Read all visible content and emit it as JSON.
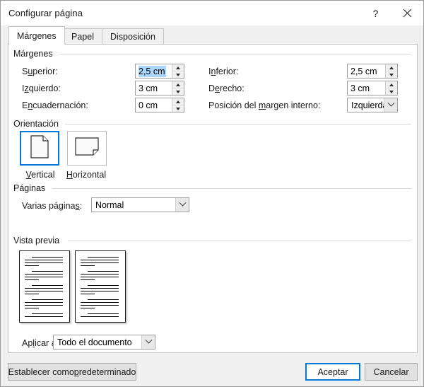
{
  "window": {
    "title": "Configurar página",
    "help_icon": "help-question-icon",
    "close_icon": "close-x-icon"
  },
  "tabs": [
    {
      "label": "Márgenes",
      "active": true
    },
    {
      "label": "Papel",
      "active": false
    },
    {
      "label": "Disposición",
      "active": false
    }
  ],
  "margins": {
    "group_label": "Márgenes",
    "fields": [
      {
        "label_pre": "S",
        "label_key": "u",
        "label_post": "perior:",
        "value": "2,5 cm",
        "selected": true
      },
      {
        "label_pre": "I",
        "label_key": "z",
        "label_post": "quierdo:",
        "value": "3 cm",
        "selected": false
      },
      {
        "label_pre": "E",
        "label_key": "n",
        "label_post": "cuadernación:",
        "value": "0 cm",
        "selected": false
      },
      {
        "label_pre": "I",
        "label_key": "n",
        "label_post": "ferior:",
        "value": "2,5 cm",
        "selected": false
      },
      {
        "label_pre": "D",
        "label_key": "e",
        "label_post": "recho:",
        "value": "3 cm",
        "selected": false
      }
    ],
    "gutter_position": {
      "label_pre": "Posición del ",
      "label_key": "m",
      "label_post": "argen interno:",
      "value": "Izquierda"
    }
  },
  "orientation": {
    "group_label": "Orientación",
    "options": [
      {
        "label_pre": "",
        "label_key": "V",
        "label_post": "ertical",
        "icon": "page-portrait-icon",
        "selected": true
      },
      {
        "label_pre": "",
        "label_key": "H",
        "label_post": "orizontal",
        "icon": "page-landscape-icon",
        "selected": false
      }
    ]
  },
  "pages": {
    "group_label": "Páginas",
    "multiple_pages": {
      "label_pre": "Varias página",
      "label_key": "s",
      "label_post": ":",
      "value": "Normal"
    }
  },
  "preview": {
    "group_label": "Vista previa",
    "pages": 2
  },
  "apply_to": {
    "label_pre": "Ap",
    "label_key": "l",
    "label_post": "icar a:",
    "value": "Todo el documento"
  },
  "buttons": {
    "set_default": {
      "pre": "Establecer como ",
      "key": "p",
      "post": "redeterminado"
    },
    "ok": {
      "label": "Aceptar",
      "default": true
    },
    "cancel": {
      "label": "Cancelar",
      "default": false
    }
  },
  "colors": {
    "accent": "#0078d7",
    "selection": "#add6ff",
    "dialog_bg": "#f0f0f0",
    "panel_bg": "#ffffff"
  }
}
